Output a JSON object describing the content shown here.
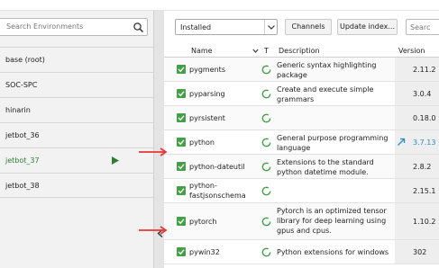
{
  "environments": {
    "search_placeholder": "Search Environments",
    "items": [
      {
        "name": "base (root)"
      },
      {
        "name": "SOC-SPC"
      },
      {
        "name": "hinarin"
      },
      {
        "name": "jetbot_36"
      },
      {
        "name": "jetbot_37"
      },
      {
        "name": "jetbot_38"
      }
    ]
  },
  "toolbar": {
    "filter_value": "Installed",
    "channels_label": "Channels",
    "update_label": "Update index...",
    "search_placeholder": "Searc"
  },
  "table": {
    "headers": {
      "name": "Name",
      "type": "T",
      "description": "Description",
      "version": "Version"
    },
    "rows": [
      {
        "name": "pygments",
        "description": "Generic syntax highlighting package",
        "version": "2.11.2"
      },
      {
        "name": "pyparsing",
        "description": "Create and execute simple grammars",
        "version": "3.0.4"
      },
      {
        "name": "pyrsistent",
        "description": "",
        "version": "0.18.0"
      },
      {
        "name": "python",
        "description": "General purpose programming language",
        "version": "3.7.13",
        "update_available": true
      },
      {
        "name": "python-dateutil",
        "description": "Extensions to the standard python datetime module.",
        "version": "2.8.2"
      },
      {
        "name": "python-fastjsonschema",
        "description": "",
        "version": "2.15.1"
      },
      {
        "name": "pytorch",
        "description": "Pytorch is an optimized tensor library for deep learning using gpus and cpus.",
        "version": "1.10.2"
      },
      {
        "name": "pywin32",
        "description": "Python extensions for windows",
        "version": "302"
      }
    ]
  },
  "colors": {
    "checkbox": "#43a047",
    "active_env": "#2e7d32",
    "update_version": "#2b8cc4",
    "annotation_arrow": "#e53935"
  }
}
